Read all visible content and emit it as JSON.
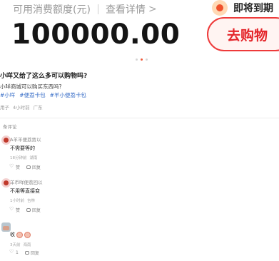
{
  "card": {
    "credit_label": "可用消费额度(元)",
    "details_label": "查看详情",
    "chevron": ">",
    "amount": "100000.00"
  },
  "promo": {
    "headline": "即将到期",
    "button_label": "去购物"
  },
  "carousel": {
    "active_index": 1,
    "count": 3
  },
  "post": {
    "title": "小咩又给了这么多可以购物吗?",
    "body": "小咩商城可以购买东西吗?",
    "tags": [
      "#小咩",
      "#便荔卡包",
      "#羊小便荔卡包"
    ],
    "author": "用子",
    "time": "4小时前",
    "location": "广东"
  },
  "comments_header": "条评论",
  "comments": [
    {
      "name": "A羊羊便荔贾以",
      "text": "不需要等的",
      "time": "18分钟前",
      "location": "湖南",
      "like_label": "赞",
      "reply_label": "回复",
      "has_emoji": false
    },
    {
      "name": "羊币咩便荔回以",
      "text": "不用等直接变",
      "time": "1小时前",
      "location": "吉林",
      "like_label": "赞",
      "reply_label": "回复",
      "has_emoji": false
    },
    {
      "name": "",
      "text": "收",
      "time": "3天前",
      "location": "海南",
      "like_label": "1",
      "reply_label": "回复",
      "has_emoji": true
    }
  ],
  "icons": {
    "promo": "gift-icon",
    "like": "heart-icon",
    "reply": "comment-icon",
    "chevron": "chevron-right-icon"
  },
  "colors": {
    "accent": "#e4252a",
    "tag": "#3a6fc8",
    "active_dot": "#f05a3a"
  }
}
